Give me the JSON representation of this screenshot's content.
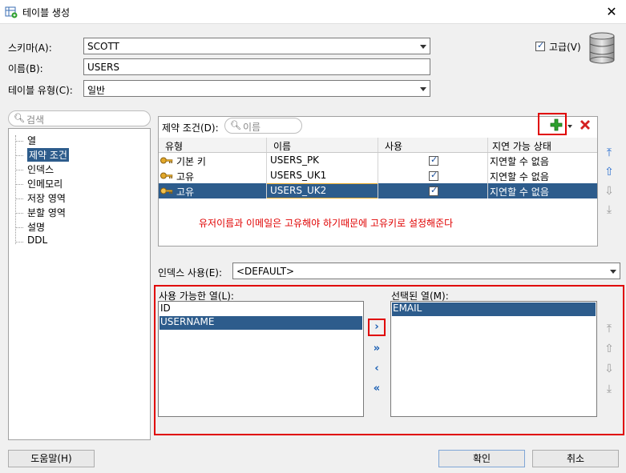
{
  "window": {
    "title": "테이블 생성",
    "close": "✕"
  },
  "form": {
    "schema_label": "스키마(A):",
    "schema_value": "SCOTT",
    "name_label": "이름(B):",
    "name_value": "USERS",
    "table_type_label": "테이블 유형(C):",
    "table_type_value": "일반",
    "advanced_label": "고급(V)",
    "advanced_checked": true
  },
  "sidebar": {
    "search_placeholder": "검색",
    "items": [
      {
        "label": "열"
      },
      {
        "label": "제약 조건",
        "selected": true
      },
      {
        "label": "인덱스"
      },
      {
        "label": "인메모리"
      },
      {
        "label": "저장 영역"
      },
      {
        "label": "분할 영역"
      },
      {
        "label": "설명"
      },
      {
        "label": "DDL"
      }
    ]
  },
  "constraints": {
    "label": "제약 조건(D):",
    "search_placeholder": "이름",
    "columns": [
      "유형",
      "이름",
      "사용",
      "지연 가능 상태"
    ],
    "rows": [
      {
        "type": "기본 키",
        "name": "USERS_PK",
        "enabled": true,
        "deferrable": "지연할 수 없음"
      },
      {
        "type": "고유",
        "name": "USERS_UK1",
        "enabled": true,
        "deferrable": "지연할 수 없음"
      },
      {
        "type": "고유",
        "name": "USERS_UK2",
        "enabled": true,
        "deferrable": "지연할 수 없음",
        "selected": true
      }
    ],
    "note": "유저이름과 이메일은 고유해야 하기때문에 고유키로 설정해준다"
  },
  "index": {
    "label": "인덱스 사용(E):",
    "value": "<DEFAULT>"
  },
  "columns_picker": {
    "available_label": "사용 가능한 열(L):",
    "available": [
      {
        "label": "ID"
      },
      {
        "label": "USERNAME",
        "selected": true
      }
    ],
    "selected_label": "선택된 열(M):",
    "selected": [
      {
        "label": "EMAIL",
        "selected": true
      }
    ]
  },
  "buttons": {
    "help": "도움말(H)",
    "ok": "확인",
    "cancel": "취소"
  },
  "colors": {
    "selection": "#2d5c8c",
    "highlight_red": "#e00000",
    "add_green": "#2ea02e",
    "delete_red": "#d42020"
  }
}
